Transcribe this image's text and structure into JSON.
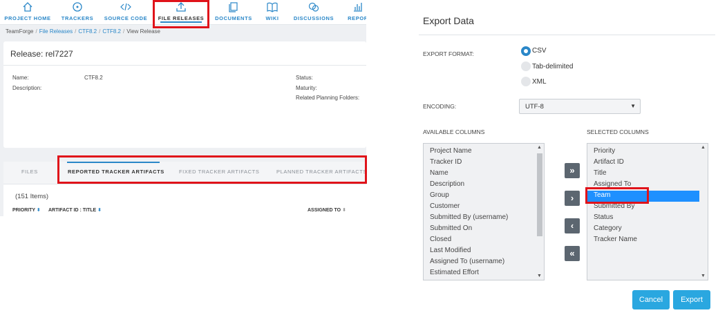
{
  "nav": {
    "items": [
      {
        "label": "PROJECT HOME",
        "icon": "home-icon"
      },
      {
        "label": "TRACKERS",
        "icon": "tracker-icon"
      },
      {
        "label": "SOURCE CODE",
        "icon": "code-icon"
      },
      {
        "label": "FILE RELEASES",
        "icon": "upload-icon"
      },
      {
        "label": "DOCUMENTS",
        "icon": "documents-icon"
      },
      {
        "label": "WIKI",
        "icon": "book-icon"
      },
      {
        "label": "DISCUSSIONS",
        "icon": "chat-icon"
      },
      {
        "label": "REPOR",
        "icon": "report-icon"
      }
    ]
  },
  "breadcrumb": {
    "root": "TeamForge",
    "items": [
      "File Releases",
      "CTF8.2",
      "CTF8.2"
    ],
    "current": "View Release",
    "sep": "/"
  },
  "release": {
    "title": "Release: rel7227",
    "name_label": "Name:",
    "name_value": "CTF8.2",
    "description_label": "Description:",
    "status_label": "Status:",
    "maturity_label": "Maturity:",
    "planning_label": "Related Planning Folders:"
  },
  "tabs": {
    "items": [
      "FILES",
      "REPORTED TRACKER ARTIFACTS",
      "FIXED TRACKER ARTIFACTS",
      "PLANNED TRACKER ARTIFACTS"
    ],
    "active": "REPORTED TRACKER ARTIFACTS"
  },
  "table": {
    "count": "(151 Items)",
    "columns": [
      "PRIORITY",
      "ARTIFACT ID : TITLE",
      "ASSIGNED TO"
    ]
  },
  "dialog": {
    "title": "Export Data",
    "export_format_label": "EXPORT FORMAT:",
    "formats": [
      "CSV",
      "Tab-delimited",
      "XML"
    ],
    "selected_format": "CSV",
    "encoding_label": "ENCODING:",
    "encoding_value": "UTF-8",
    "available_label": "AVAILABLE COLUMNS",
    "selected_label": "SELECTED COLUMNS",
    "available_columns": [
      "Project Name",
      "Tracker ID",
      "Name",
      "Description",
      "Group",
      "Customer",
      "Submitted By (username)",
      "Submitted On",
      "Closed",
      "Last Modified",
      "Assigned To (username)",
      "Estimated Effort"
    ],
    "selected_columns": [
      "Priority",
      "Artifact ID",
      "Title",
      "Assigned To",
      "Team",
      "Submitted By",
      "Status",
      "Category",
      "Tracker Name"
    ],
    "highlighted_column": "Team",
    "move_buttons": [
      "»",
      "›",
      "‹",
      "«"
    ],
    "cancel_label": "Cancel",
    "export_label": "Export"
  },
  "colors": {
    "accent": "#2a87c8",
    "button": "#2aa7e0",
    "highlight_box": "#e0131a",
    "selection": "#1e90ff"
  }
}
